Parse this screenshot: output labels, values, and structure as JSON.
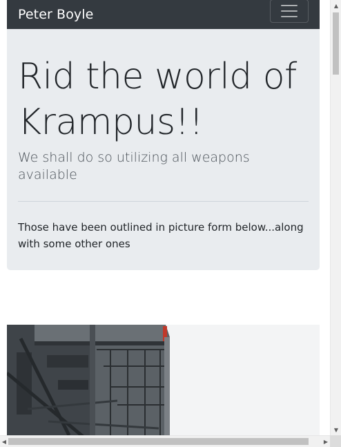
{
  "navbar": {
    "brand": "Peter Boyle",
    "toggler_icon": "hamburger-menu-icon",
    "bg_color": "#343a40"
  },
  "jumbotron": {
    "title": "Rid the world of Krampus!!",
    "lead": "We shall do so utilizing all weapons available",
    "body": "Those have been outlined in picture form below...along with some other ones",
    "bg_color": "#e9ecef"
  },
  "photo": {
    "subject": "warship-superstructure-photo"
  },
  "scrollbars": {
    "vertical_up_icon": "scroll-up-arrow-icon",
    "vertical_down_icon": "scroll-down-arrow-icon",
    "horizontal_left_icon": "scroll-left-arrow-icon",
    "horizontal_right_icon": "scroll-right-arrow-icon"
  }
}
